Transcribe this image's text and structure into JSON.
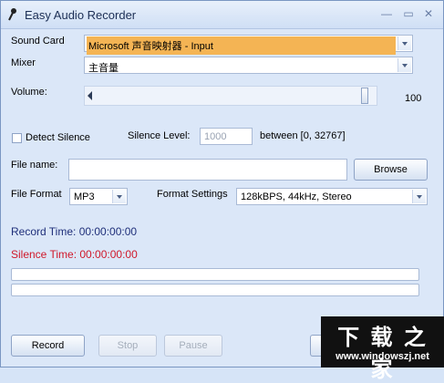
{
  "window": {
    "title": "Easy Audio Recorder"
  },
  "labels": {
    "sound_card": "Sound Card",
    "mixer": "Mixer",
    "volume": "Volume:",
    "detect_silence": "Detect Silence",
    "silence_level": "Silence Level:",
    "between": "between [0, 32767]",
    "file_name": "File name:",
    "file_format": "File Format",
    "format_settings": "Format Settings"
  },
  "sound_card": {
    "value": "Microsoft 声音映射器 - Input"
  },
  "mixer": {
    "value": "主音量"
  },
  "volume": {
    "value": "100",
    "level_fraction": 1.0
  },
  "detect_silence": {
    "checked": false
  },
  "silence_level": {
    "value": "1000"
  },
  "file_name": {
    "value": ""
  },
  "file_format": {
    "value": "MP3"
  },
  "format_settings": {
    "value": "128kBPS, 44kHz, Stereo"
  },
  "status": {
    "record_time": "Record Time: 00:00:00:00",
    "silence_time": "Silence Time: 00:00:00:00"
  },
  "buttons": {
    "browse": "Browse",
    "record": "Record",
    "stop": "Stop",
    "pause": "Pause"
  },
  "colors": {
    "record_time": "#1f2f7a",
    "silence_time": "#d0182a",
    "selection": "#f4b454"
  },
  "watermark": {
    "title": "下 载 之 家",
    "url": "www.windowszj.net"
  }
}
